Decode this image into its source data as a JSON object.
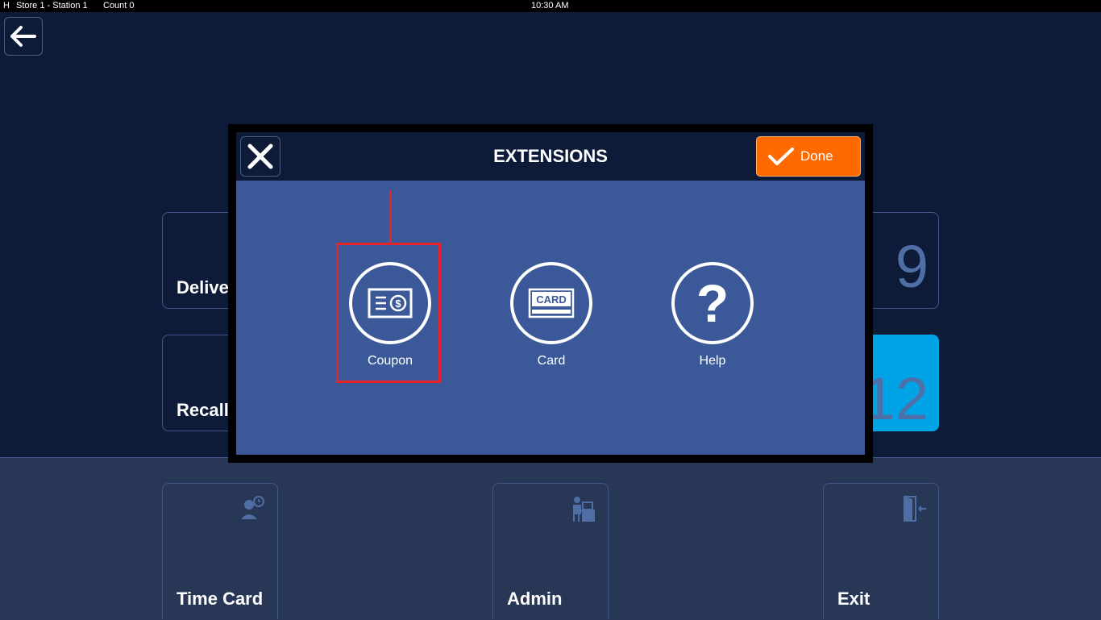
{
  "status_bar": {
    "mode": "H",
    "store_station": "Store 1 - Station 1",
    "count": "Count 0",
    "time": "10:30 AM"
  },
  "home": {
    "tiles": [
      {
        "label": "Delive",
        "count": "9"
      },
      {
        "label": "Recall",
        "count": "12"
      }
    ],
    "bottom_tiles": [
      {
        "label": "Time Card",
        "icon": "time-card-icon"
      },
      {
        "label": "Admin",
        "icon": "admin-desk-icon"
      },
      {
        "label": "Exit",
        "icon": "exit-door-icon"
      }
    ]
  },
  "modal": {
    "title": "EXTENSIONS",
    "done_label": "Done",
    "items": [
      {
        "label": "Coupon",
        "icon": "coupon-icon"
      },
      {
        "label": "Card",
        "icon": "card-icon",
        "icon_text": "CARD"
      },
      {
        "label": "Help",
        "icon": "help-icon",
        "icon_text": "?"
      }
    ]
  },
  "colors": {
    "background": "#0d1b38",
    "modal_body": "#3b5998",
    "done_button": "#ff6a00",
    "highlight_tile": "#00a3e6",
    "annotation": "#e8222a"
  }
}
